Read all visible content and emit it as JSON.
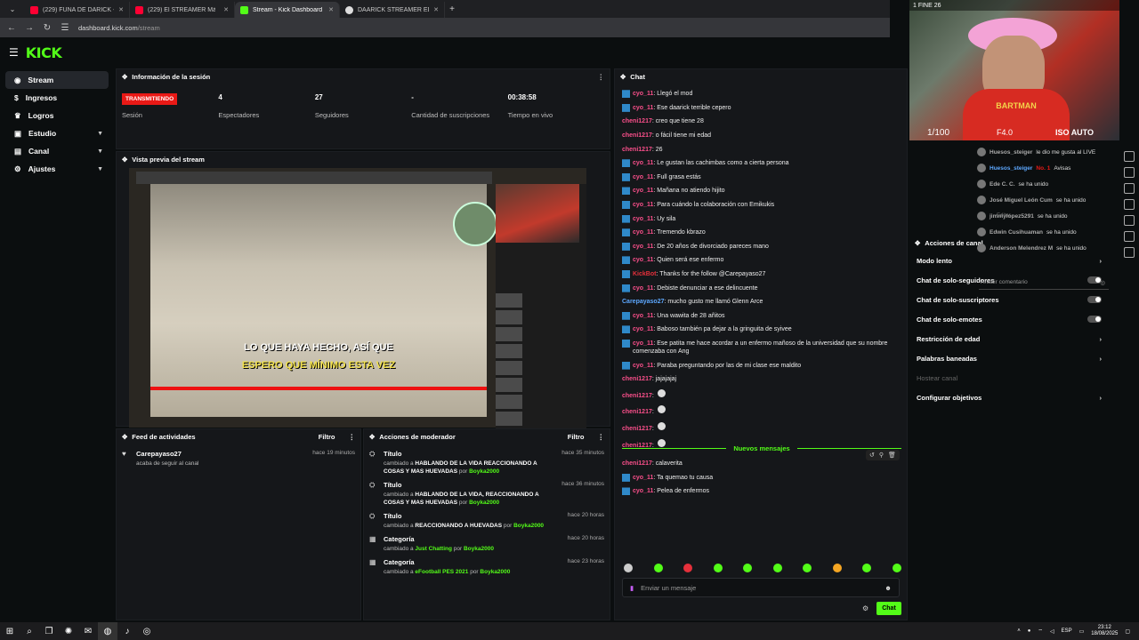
{
  "browser": {
    "tabs": [
      {
        "label": "(229) FUNA DE DARICK - YouTube",
        "color": "#ff0033"
      },
      {
        "label": "(229) El STREAMER Más ENFERMO",
        "color": "#ff0033"
      },
      {
        "label": "Stream - Kick Dashboard",
        "color": "#53fc18"
      },
      {
        "label": "DAARICK STREAMER EDAD - B",
        "color": "#dddddd"
      }
    ],
    "url_host": "dashboard.kick.com",
    "url_path": "/stream"
  },
  "app": {
    "logo": "KICK",
    "accent": "#53fc18"
  },
  "sidebar": {
    "items": [
      {
        "label": "Stream",
        "icon": "stream-icon"
      },
      {
        "label": "Ingresos",
        "icon": "dollar-icon"
      },
      {
        "label": "Logros",
        "icon": "trophy-icon"
      },
      {
        "label": "Estudio",
        "icon": "studio-icon"
      },
      {
        "label": "Canal",
        "icon": "channel-icon"
      },
      {
        "label": "Ajustes",
        "icon": "gear-icon"
      }
    ]
  },
  "session": {
    "title": "Información de la sesión",
    "status_badge": "TRANSMITIENDO",
    "stats": [
      {
        "value": "",
        "label": "Sesión"
      },
      {
        "value": "4",
        "label": "Espectadores"
      },
      {
        "value": "27",
        "label": "Seguidores"
      },
      {
        "value": "-",
        "label": "Cantidad de suscripciones"
      },
      {
        "value": "00:38:58",
        "label": "Tiempo en vivo"
      }
    ]
  },
  "preview": {
    "title": "Vista previa del stream",
    "subtitle_line1": "LO QUE HAYA HECHO, ASÍ QUE",
    "subtitle_line2": "ESPERO QUE MÍNIMO ESTA VEZ"
  },
  "feed": {
    "title": "Feed de actividades",
    "filter": "Filtro",
    "items": [
      {
        "user": "Carepayaso27",
        "text": "acaba de seguir al canal",
        "time": "hace 19 minutos"
      }
    ]
  },
  "modactions": {
    "title": "Acciones de moderador",
    "filter": "Filtro",
    "by_label": "por",
    "items": [
      {
        "title": "Título",
        "prefix": "cambiado a",
        "value": "HABLANDO DE LA VIDA REACCIONANDO A COSAS Y MAS HUEVADAS",
        "by": "Boyka2000",
        "time": "hace 35 minutos",
        "icon": "title-icon"
      },
      {
        "title": "Título",
        "prefix": "cambiado a",
        "value": "HABLANDO DE LA VIDA, REACCIONANDO A COSAS Y MAS HUEVADAS",
        "by": "Boyka2000",
        "time": "hace 36 minutos",
        "icon": "title-icon"
      },
      {
        "title": "Título",
        "prefix": "cambiado a",
        "value": "REACCIONANDO A HUEVADAS",
        "by": "Boyka2000",
        "time": "hace 20 horas",
        "icon": "title-icon"
      },
      {
        "title": "Categoría",
        "prefix": "cambiado a",
        "value": "Just Chatting",
        "by": "Boyka2000",
        "time": "hace 20 horas",
        "icon": "category-icon"
      },
      {
        "title": "Categoría",
        "prefix": "cambiado a",
        "value": "eFootball PES 2021",
        "by": "Boyka2000",
        "time": "hace 23 horas",
        "icon": "category-icon"
      }
    ]
  },
  "chat": {
    "title": "Chat",
    "messages": [
      {
        "user": "cyo_11",
        "text": "Llegó el mod",
        "cls": "u-cyo",
        "badge": true
      },
      {
        "user": "cyo_11",
        "text": "Ese daarick terrible cepero",
        "cls": "u-cyo",
        "badge": true
      },
      {
        "user": "cheni1217",
        "text": "creo que tiene 28",
        "cls": "u-chen",
        "badge": false
      },
      {
        "user": "cheni1217",
        "text": "o fácil tiene mi edad",
        "cls": "u-chen",
        "badge": false
      },
      {
        "user": "cheni1217",
        "text": "26",
        "cls": "u-chen",
        "badge": false
      },
      {
        "user": "cyo_11",
        "text": "Le gustan las cachimbas como a cierta persona",
        "cls": "u-cyo",
        "badge": true
      },
      {
        "user": "cyo_11",
        "text": "Full grasa estás",
        "cls": "u-cyo",
        "badge": true
      },
      {
        "user": "cyo_11",
        "text": "Mañana no atiendo hijito",
        "cls": "u-cyo",
        "badge": true
      },
      {
        "user": "cyo_11",
        "text": "Para cuándo la colaboración con Emikukis",
        "cls": "u-cyo",
        "badge": true
      },
      {
        "user": "cyo_11",
        "text": "Uy sila",
        "cls": "u-cyo",
        "badge": true
      },
      {
        "user": "cyo_11",
        "text": "Tremendo kbrazo",
        "cls": "u-cyo",
        "badge": true
      },
      {
        "user": "cyo_11",
        "text": "De 20 años de divorciado pareces mano",
        "cls": "u-cyo",
        "badge": true
      },
      {
        "user": "cyo_11",
        "text": "Quien será ese enfermo",
        "cls": "u-cyo",
        "badge": true
      },
      {
        "user": "KickBot",
        "text": "Thanks for the follow @Carepayaso27",
        "cls": "u-kick",
        "badge": true
      },
      {
        "user": "cyo_11",
        "text": "Debiste denunciar a ese delincuente",
        "cls": "u-cyo",
        "badge": true
      },
      {
        "user": "Carepayaso27",
        "text": "mucho gusto me llamó Glenn Arce",
        "cls": "u-care",
        "badge": false
      },
      {
        "user": "cyo_11",
        "text": "Una wawita de 28 añitos",
        "cls": "u-cyo",
        "badge": true
      },
      {
        "user": "cyo_11",
        "text": "Baboso también pa dejar a la gringuita de syivee",
        "cls": "u-cyo",
        "badge": true
      },
      {
        "user": "cyo_11",
        "text": "Ese patita me hace acordar a un enfermo mañoso de la universidad que su nombre comenzaba con Ang",
        "cls": "u-cyo",
        "badge": true
      },
      {
        "user": "cyo_11",
        "text": "Paraba preguntando por las de mi clase ese maldito",
        "cls": "u-cyo",
        "badge": true
      },
      {
        "user": "cheni1217",
        "text": "jajajajaj",
        "cls": "u-chen",
        "badge": false
      },
      {
        "user": "cheni1217",
        "text": "",
        "cls": "u-chen",
        "badge": false,
        "emote": true
      },
      {
        "user": "cheni1217",
        "text": "",
        "cls": "u-chen",
        "badge": false,
        "emote": true
      },
      {
        "user": "cheni1217",
        "text": "",
        "cls": "u-chen",
        "badge": false,
        "emote": true
      },
      {
        "user": "cheni1217",
        "text": "",
        "cls": "u-chen",
        "badge": false,
        "emote": true
      }
    ],
    "new_messages_label": "Nuevos mensajes",
    "new_messages": [
      {
        "user": "cheni1217",
        "text": "calaverita",
        "cls": "u-chen",
        "badge": false
      },
      {
        "user": "cyo_11",
        "text": "Ta quemao tu causa",
        "cls": "u-cyo",
        "badge": true
      },
      {
        "user": "cyo_11",
        "text": "Pelea de enfermos",
        "cls": "u-cyo",
        "badge": true
      }
    ],
    "input_placeholder": "Enviar un mensaje",
    "send_label": "Chat"
  },
  "mod_panel": {
    "title": "Acciones de canal",
    "rows": [
      {
        "label": "Modo lento",
        "kind": "chev"
      },
      {
        "label": "Chat de solo-seguidores",
        "kind": "toggle"
      },
      {
        "label": "Chat de solo-suscriptores",
        "kind": "toggle"
      },
      {
        "label": "Chat de solo-emotes",
        "kind": "toggle"
      },
      {
        "label": "Restricción de edad",
        "kind": "chev"
      },
      {
        "label": "Palabras baneadas",
        "kind": "chev"
      },
      {
        "label": "Hostear canal",
        "kind": "dim"
      },
      {
        "label": "Configurar objetivos",
        "kind": "chev"
      }
    ]
  },
  "camera": {
    "top_text": "1 FINE 26",
    "iso": "ISO",
    "auto": "AUTO",
    "timecode": "1/100",
    "fstop": "F4.0",
    "shirt_text": "BARTMAN"
  },
  "overlay": {
    "items": [
      {
        "name": "Huesos_steiger",
        "text": "le dio me gusta al LIVE",
        "style": "n"
      },
      {
        "name": "Huesos_steiger",
        "text": "Avisas",
        "style": "hl",
        "tag": "No. 1"
      },
      {
        "name": "Ede C. C.",
        "text": "se ha unido",
        "style": "n"
      },
      {
        "name": "José Miguel León Cum",
        "text": "se ha unido",
        "style": "n"
      },
      {
        "name": "jimmylopez5291",
        "text": "se ha unido",
        "style": "n"
      },
      {
        "name": "Edwin Cusihuaman",
        "text": "se ha unido",
        "style": "n"
      },
      {
        "name": "Anderson Melendrez M",
        "text": "se ha unido",
        "style": "n"
      }
    ],
    "edit_label": "Editar",
    "comment_placeholder": "Añadir comentario"
  },
  "taskbar": {
    "lang": "ESP",
    "time": "23:12",
    "date": "18/08/2025"
  }
}
